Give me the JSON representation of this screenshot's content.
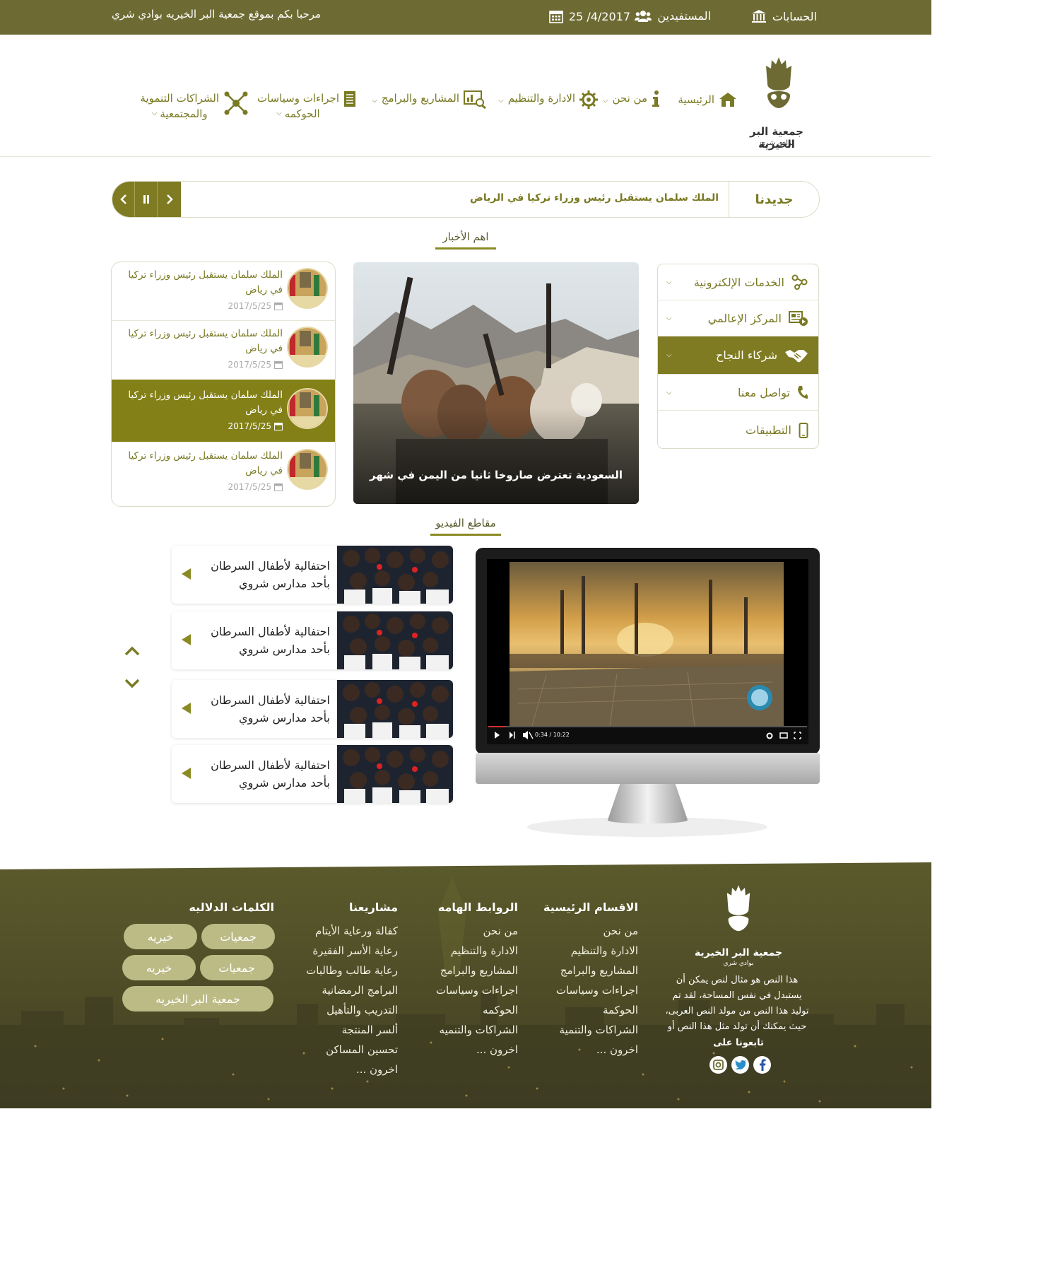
{
  "topbar": {
    "accounts": "الحسابات",
    "beneficiaries": "المستفيدين",
    "date": "25 /4/2017",
    "welcome": "مرحبا بكم بموقع جمعية البر الخيريه بوادي شري"
  },
  "logo": {
    "line1": "جمعية البر الخيرية",
    "line2": "بوادي شري"
  },
  "nav": {
    "home": "الرئيسية",
    "about": "من نحن",
    "admin": "الادارة والتنظيم",
    "projects": "المشاريع والبرامج",
    "gov_line1": "اجراءات وسياسات",
    "gov_line2": "الحوكمه",
    "partners_line1": "الشراكات التنموية",
    "partners_line2": "والمجتمعية"
  },
  "ticker": {
    "label": "جديدنا",
    "headline": "الملك سلمان يستقبل رئيس وزراء تركيا في الرياض"
  },
  "news_section": {
    "title": "اهم الأخبار"
  },
  "side_menu": [
    {
      "label": "الخدمات الإلكترونية",
      "icon": "services-icon"
    },
    {
      "label": "المركز الإعالمي",
      "icon": "media-icon"
    },
    {
      "label": "شركاء النجاح",
      "icon": "handshake-icon"
    },
    {
      "label": "تواصل معنا",
      "icon": "phone-icon"
    },
    {
      "label": "التطبيقات",
      "icon": "mobile-icon"
    }
  ],
  "featured": {
    "caption": "السعودية تعترض صاروخا ثانيا من اليمن في شهر"
  },
  "news_list": [
    {
      "title": "الملك سلمان يستقبل رئيس وزراء تركيا في رياض",
      "date": "2017/5/25"
    },
    {
      "title": "الملك سلمان يستقبل رئيس وزراء تركيا في رياض",
      "date": "2017/5/25"
    },
    {
      "title": "الملك سلمان يستقبل رئيس وزراء تركيا في رياض",
      "date": "2017/5/25"
    },
    {
      "title": "الملك سلمان يستقبل رئيس وزراء تركيا في رياض",
      "date": "2017/5/25"
    }
  ],
  "video_section": {
    "title": "مقاطع الفيديو",
    "player_time": "0:34 / 10:22",
    "progress": 0.055
  },
  "videos": [
    {
      "line1": "احتفالية لأطفال السرطان",
      "line2": "بأحد مدارس شروي"
    },
    {
      "line1": "احتفالية لأطفال السرطان",
      "line2": "بأحد مدارس شروي"
    },
    {
      "line1": "احتفالية لأطفال السرطان",
      "line2": "بأحد مدارس شروي"
    },
    {
      "line1": "احتفالية لأطفال السرطان",
      "line2": "بأحد مدارس شروي"
    }
  ],
  "footer": {
    "about_text": [
      "هذا النص هو مثال لنص يمكن أن",
      "يستبدل في نفس المساحة، لقد تم",
      "توليد هذا النص من مولد النص العربى،",
      "حيث يمكنك أن تولد مثل هذا النص أو"
    ],
    "follow": "تابعونا على",
    "col_main": {
      "title": "الاقسام الرئيسية",
      "links": [
        "من نحن",
        "الادارة والتنظيم",
        "المشاريع والبرامج",
        "اجراءات وسياسات",
        "الحوكمة",
        "الشراكات والتنمية",
        "اخرون ..."
      ]
    },
    "col_links": {
      "title": "الروابط الهامه",
      "links": [
        "من نحن",
        "الادارة والتنظيم",
        "المشاريع والبرامج",
        "اجراءات وسياسات",
        "الحوكمه",
        "الشراكات والتنميه",
        "اخرون ..."
      ]
    },
    "col_projects": {
      "title": "مشاريعنا",
      "links": [
        "كفالة ورعاية الأيتام",
        "رعاية الأسر الفقيرة",
        "رعاية طالب وطالبات",
        "البرامج الرمضانية",
        "التدريب والتأهيل",
        "ألسر المنتجة",
        "تحسين المساكن",
        "اخرون ..."
      ]
    },
    "keywords": {
      "title": "الكلمات الدلاليه",
      "tags": [
        "جمعيات",
        "خيريه",
        "جمعيات",
        "خيريه",
        "جمعية البر الخيريه"
      ]
    }
  },
  "colors": {
    "brand": "#6d6b33",
    "accent": "#7e7b22"
  }
}
